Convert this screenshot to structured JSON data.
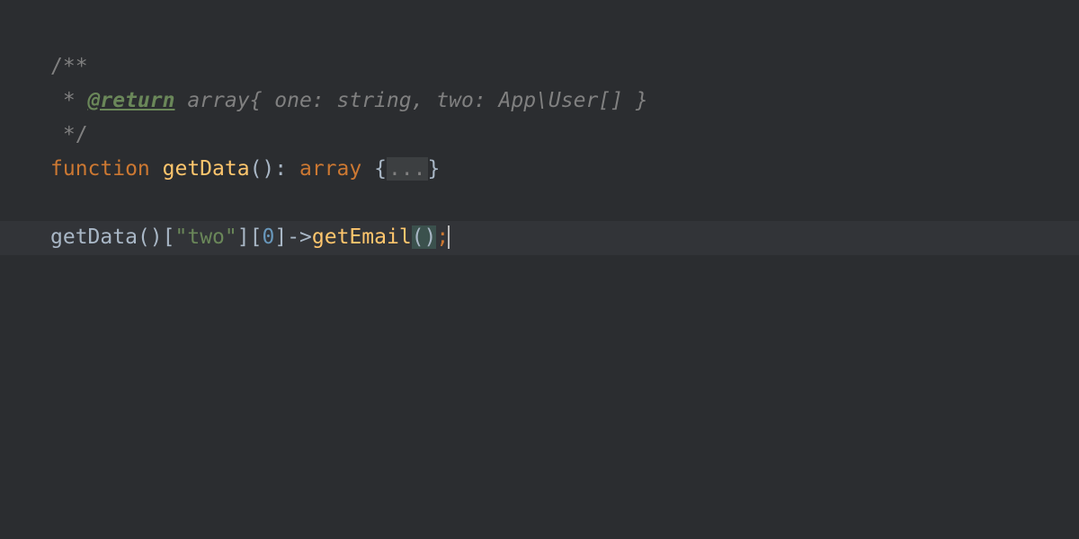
{
  "code": {
    "doc_open": "/**",
    "doc_star": " * ",
    "doc_tag": "@return",
    "doc_text": " array{ one: string, two: App\\User[] }",
    "doc_close": " */",
    "keyword_function": "function",
    "fn_name": "getData",
    "fn_parens": "()",
    "colon": ": ",
    "return_type": "array",
    "space": " ",
    "brace_open": "{",
    "collapsed": "...",
    "brace_close": "}",
    "call_name": "getData",
    "call_parens": "()",
    "bracket_open1": "[",
    "string_key": "\"two\"",
    "bracket_close1": "]",
    "bracket_open2": "[",
    "index": "0",
    "bracket_close2": "]",
    "arrow": "->",
    "method_name": "getEmail",
    "paren_open": "(",
    "paren_close": ")",
    "semicolon": ";"
  }
}
